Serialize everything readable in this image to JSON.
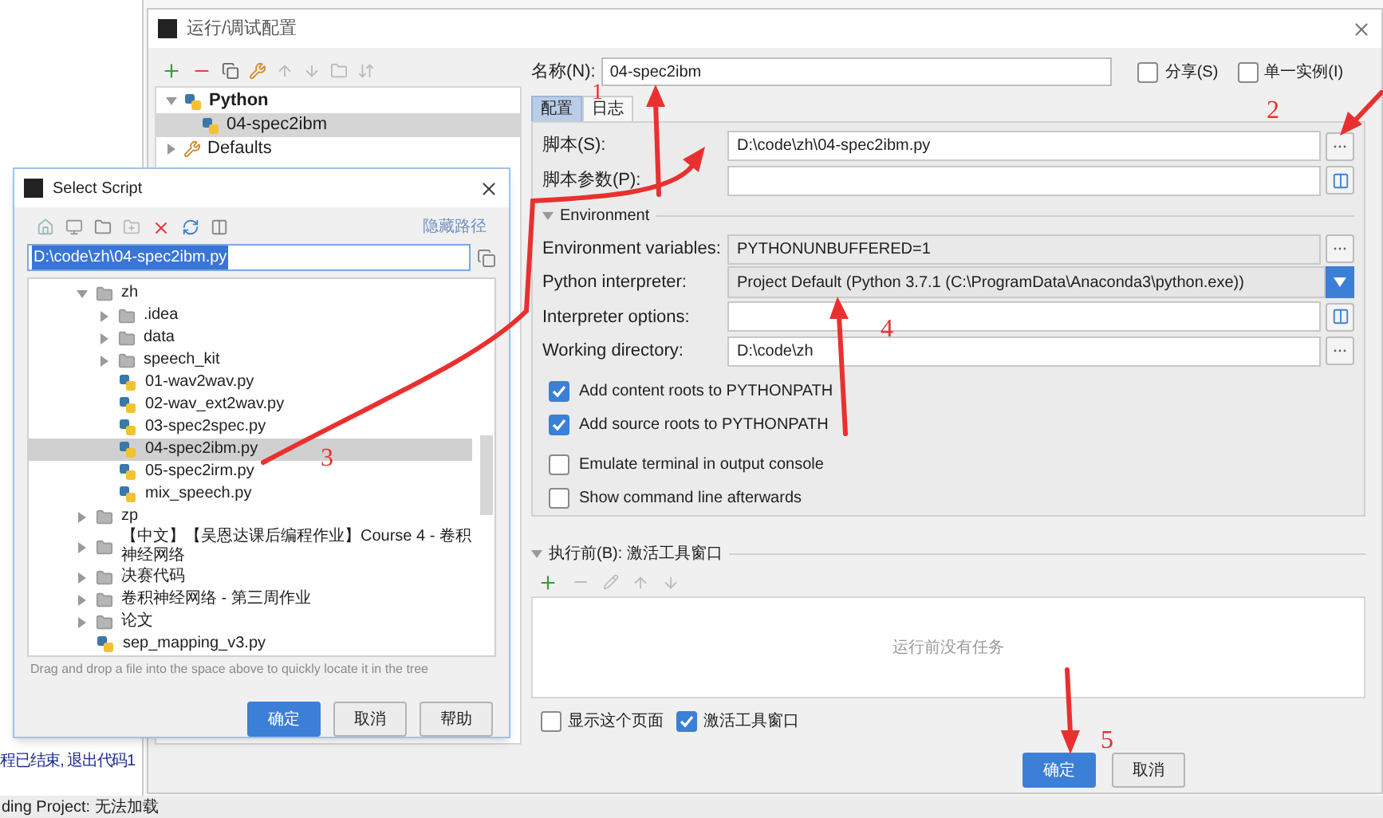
{
  "background": {
    "console_text": "程已结束, 退出代码1",
    "status_text": "ding Project: 无法加载"
  },
  "main_dialog": {
    "title": "运行/调试配置",
    "config_tree": [
      {
        "label": "Python",
        "kind": "python",
        "expanded": true,
        "selected": false,
        "children": [
          {
            "label": "04-spec2ibm",
            "kind": "python-file",
            "selected": true
          }
        ]
      },
      {
        "label": "Defaults",
        "kind": "defaults",
        "expanded": false,
        "selected": false
      }
    ],
    "name_label": "名称(N):",
    "name_value": "04-spec2ibm",
    "options": [
      {
        "label": "分享(S)",
        "checked": false
      },
      {
        "label": "单一实例(I)",
        "checked": false
      }
    ],
    "tabs": [
      {
        "label": "配置",
        "selected": true
      },
      {
        "label": "日志",
        "selected": false
      }
    ],
    "fields": [
      {
        "label": "脚本(S):",
        "value": "D:\\code\\zh\\04-spec2ibm.py",
        "kind": "browse"
      },
      {
        "label": "脚本参数(P):",
        "kind": "expand"
      }
    ],
    "environment": {
      "title": "Environment",
      "expanded": true,
      "fields": [
        {
          "label": "Environment variables:",
          "value": "PYTHONUNBUFFERED=1",
          "kind": "browse",
          "readonly": true
        },
        {
          "label": "Python interpreter:",
          "value": "Project Default (Python 3.7.1 (C:\\ProgramData\\Anaconda3\\python.exe))",
          "kind": "dropdown"
        },
        {
          "label": "Interpreter options:",
          "kind": "expand"
        },
        {
          "label": "Working directory:",
          "value": "D:\\code\\zh",
          "kind": "browse",
          "readonly": false
        }
      ]
    },
    "checkboxes": [
      {
        "label": "Add content roots to PYTHONPATH",
        "checked": true
      },
      {
        "label": "Add source roots to PYTHONPATH",
        "checked": true
      },
      {
        "label": "Emulate terminal in output console",
        "checked": false
      },
      {
        "label": "Show command line afterwards",
        "checked": false
      }
    ],
    "before_launch": {
      "title": "执行前(B): 激活工具窗口",
      "expanded": true,
      "empty_text": "运行前没有任务",
      "options": [
        {
          "label": "显示这个页面",
          "checked": false
        },
        {
          "label": "激活工具窗口",
          "checked": true
        }
      ]
    },
    "buttons": [
      {
        "label": "确定",
        "primary": true
      },
      {
        "label": "取消",
        "primary": false
      }
    ]
  },
  "select_script": {
    "title": "Select Script",
    "hide_path_link": "隐藏路径",
    "path": "D:\\code\\zh\\04-spec2ibm.py",
    "tree": [
      {
        "label": "zh",
        "kind": "folder",
        "expanded": true,
        "selected": false,
        "children": [
          {
            "label": ".idea",
            "kind": "folder",
            "expanded": false,
            "selected": false
          },
          {
            "label": "data",
            "kind": "folder",
            "expanded": false,
            "selected": false
          },
          {
            "label": "speech_kit",
            "kind": "folder",
            "expanded": false,
            "selected": false
          },
          {
            "label": "01-wav2wav.py",
            "kind": "file",
            "selected": false
          },
          {
            "label": "02-wav_ext2wav.py",
            "kind": "file",
            "selected": false
          },
          {
            "label": "03-spec2spec.py",
            "kind": "file",
            "selected": false
          },
          {
            "label": "04-spec2ibm.py",
            "kind": "file",
            "selected": true
          },
          {
            "label": "05-spec2irm.py",
            "kind": "file",
            "selected": false
          },
          {
            "label": "mix_speech.py",
            "kind": "file",
            "selected": false
          }
        ]
      },
      {
        "label": "zp",
        "kind": "folder",
        "expanded": false,
        "selected": false
      },
      {
        "label": "【中文】【吴恩达课后编程作业】Course 4 - 卷积神经网络",
        "kind": "folder",
        "expanded": false,
        "selected": false
      },
      {
        "label": "决赛代码",
        "kind": "folder",
        "expanded": false,
        "selected": false
      },
      {
        "label": "卷积神经网络 - 第三周作业",
        "kind": "folder",
        "expanded": false,
        "selected": false
      },
      {
        "label": "论文",
        "kind": "folder",
        "expanded": false,
        "selected": false
      },
      {
        "label": "sep_mapping_v3.py",
        "kind": "file",
        "selected": false
      }
    ],
    "hint": "Drag and drop a file into the space above to quickly locate it in the tree",
    "buttons": [
      {
        "label": "确定",
        "primary": true
      },
      {
        "label": "取消",
        "primary": false
      },
      {
        "label": "帮助",
        "primary": false
      }
    ]
  },
  "annotations": [
    "1",
    "2",
    "3",
    "4",
    "5"
  ]
}
